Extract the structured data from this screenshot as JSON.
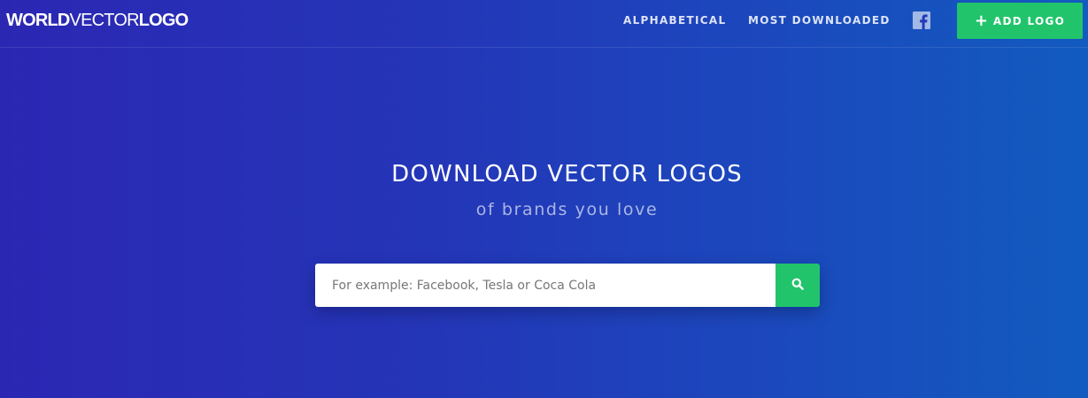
{
  "brand": {
    "logo_world": "WORLD",
    "logo_vector": "VECTOR",
    "logo_logo": "LOGO"
  },
  "nav": {
    "alphabetical": "ALPHABETICAL",
    "most_downloaded": "MOST DOWNLOADED",
    "facebook_icon": "facebook-icon",
    "add_logo_plus": "+",
    "add_logo": "ADD LOGO"
  },
  "hero": {
    "title": "DOWNLOAD VECTOR LOGOS",
    "subtitle": "of brands you love"
  },
  "search": {
    "value": "",
    "placeholder": "For example: Facebook, Tesla or Coca Cola",
    "button_icon": "search-icon"
  },
  "colors": {
    "accent_green": "#21c46b",
    "background_start": "#2b27b3",
    "background_end": "#125bbf"
  }
}
